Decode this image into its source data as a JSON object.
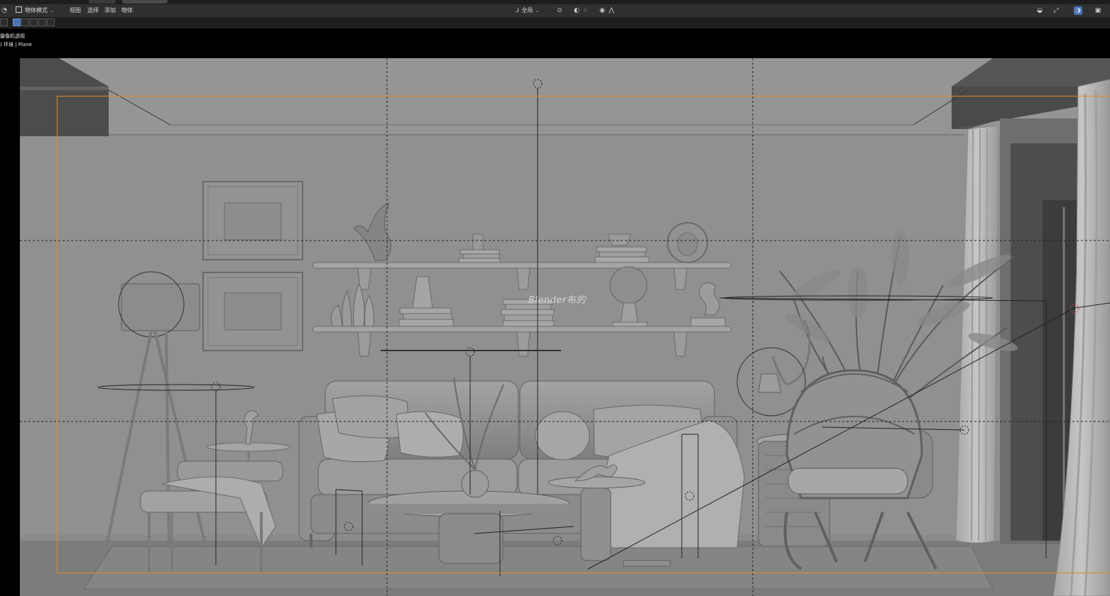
{
  "header": {
    "mode_label": "物体模式",
    "menu": [
      "视图",
      "选择",
      "添加",
      "物体"
    ],
    "pivot_label": "全局"
  },
  "overlay": {
    "view_label": "摄像机透视",
    "collection_label": ") 环境 | Plane"
  },
  "watermark": "Blender布的",
  "colors": {
    "header_bg": "#303030",
    "viewport_bg": "#909090",
    "camera_frame": "#e08a24",
    "selected_tool": "#4772b3"
  },
  "icons": {
    "editor_type": "view3d-icon",
    "mode": "object-mode-icon",
    "transform_orientation": "orientation-icon",
    "snap": "magnet-icon",
    "proportional": "proportional-edit-icon",
    "visibility": "eye-icon",
    "gizmo": "gizmo-icon",
    "overlay": "overlay-icon",
    "xray": "xray-icon"
  }
}
